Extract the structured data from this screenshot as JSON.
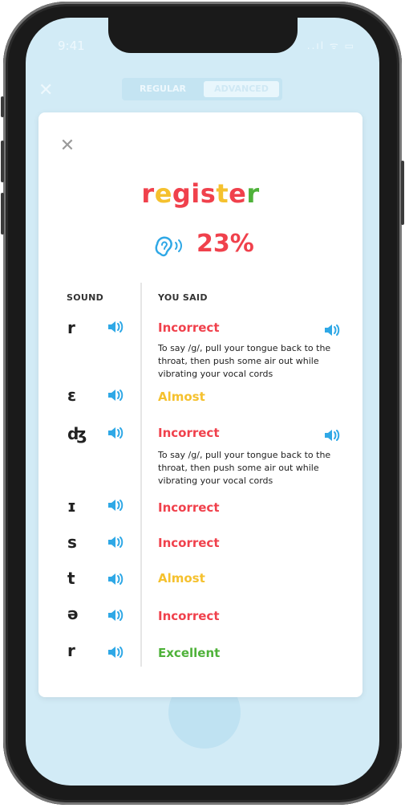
{
  "status": {
    "time": "9:41",
    "icons": "..ıl ᯤ ▭"
  },
  "app": {
    "close": "✕",
    "modes": [
      "REGULAR",
      "ADVANCED"
    ]
  },
  "modal": {
    "close": "✕",
    "word_letters": [
      {
        "ch": "r",
        "color": "#f0414c"
      },
      {
        "ch": "e",
        "color": "#f5c12e"
      },
      {
        "ch": "g",
        "color": "#f0414c"
      },
      {
        "ch": "i",
        "color": "#f0414c"
      },
      {
        "ch": "s",
        "color": "#f0414c"
      },
      {
        "ch": "t",
        "color": "#f5c12e"
      },
      {
        "ch": "e",
        "color": "#f0414c"
      },
      {
        "ch": "r",
        "color": "#4fb23a"
      }
    ],
    "score": "23%",
    "headers": {
      "sound": "SOUND",
      "you_said": "YOU SAID"
    },
    "rows": [
      {
        "symbol": "r",
        "result": "Incorrect",
        "status": "bad",
        "tip": "To say /g/, pull your tongue back to the throat, then push some air out while vibrating your vocal cords"
      },
      {
        "symbol": "ɛ",
        "result": "Almost",
        "status": "mid"
      },
      {
        "symbol": "ʤ",
        "result": "Incorrect",
        "status": "bad",
        "tip": "To say /g/, pull your tongue back to the throat, then push some air out while vibrating your vocal cords"
      },
      {
        "symbol": "ɪ",
        "result": "Incorrect",
        "status": "bad"
      },
      {
        "symbol": "s",
        "result": "Incorrect",
        "status": "bad"
      },
      {
        "symbol": "t",
        "result": "Almost",
        "status": "mid"
      },
      {
        "symbol": "ə",
        "result": "Incorrect",
        "status": "bad"
      },
      {
        "symbol": "r",
        "result": "Excellent",
        "status": "good"
      }
    ]
  },
  "colors": {
    "incorrect": "#f0414c",
    "almost": "#f5c12e",
    "excellent": "#4fb23a",
    "speaker": "#2fa8e6"
  }
}
